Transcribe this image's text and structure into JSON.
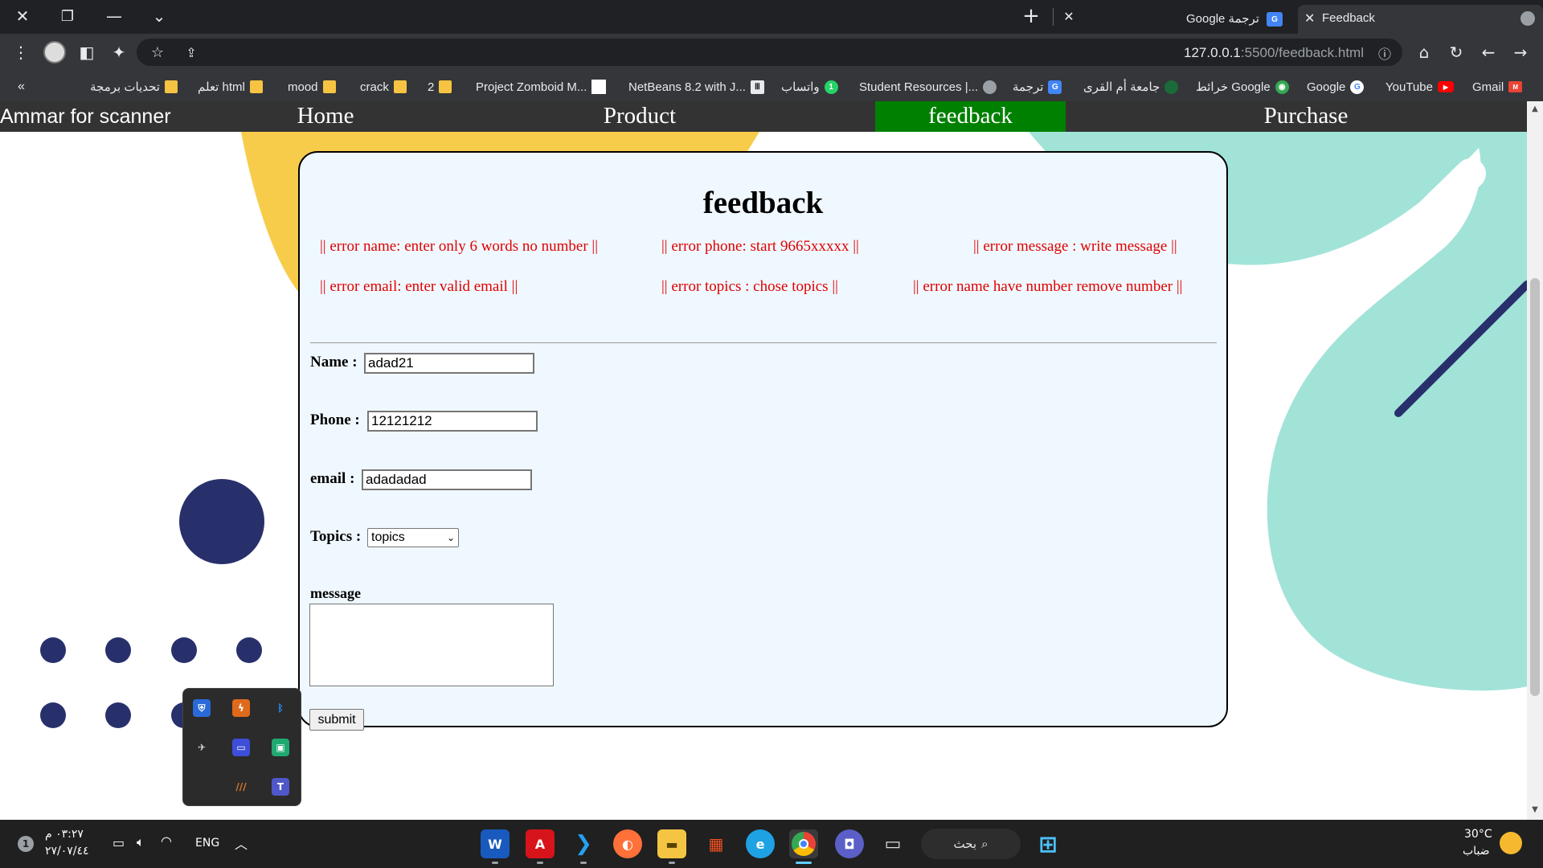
{
  "window": {
    "close_glyph": "✕",
    "restore_glyph": "❐",
    "minimize_glyph": "—",
    "tabsearch_glyph": "⌄"
  },
  "tabs": [
    {
      "title": "Feedback",
      "active": true
    },
    {
      "title": "Google ترجمة",
      "active": false
    }
  ],
  "tab_controls": {
    "new_tab_glyph": "+",
    "close_glyph": "✕"
  },
  "omnibox": {
    "url_host": "127.0.0.1",
    "url_rest": ":5500/feedback.html"
  },
  "bookmarks": [
    {
      "label": "Gmail",
      "icon": "gmail-icon",
      "color": "#ea4335"
    },
    {
      "label": "YouTube",
      "icon": "youtube-icon",
      "color": "#ff0000"
    },
    {
      "label": "Google",
      "icon": "google-icon",
      "color": "#4285f4"
    },
    {
      "label": "خرائط Google",
      "icon": "maps-icon",
      "color": "#34a853"
    },
    {
      "label": "جامعة أم القرى",
      "icon": "university-icon",
      "color": "#1b6b3a"
    },
    {
      "label": "ترجمة",
      "icon": "translate-icon",
      "color": "#4285f4"
    },
    {
      "label": "Student Resources |...",
      "icon": "globe-icon",
      "color": "#9aa0a6"
    },
    {
      "label": "واتساب",
      "icon": "whatsapp-icon",
      "color": "#25d366"
    },
    {
      "label": "NetBeans 8.2 with J...",
      "icon": "bank-icon",
      "color": "#e8eaed"
    },
    {
      "label": "Project Zomboid M...",
      "icon": "page-icon",
      "color": "#ffffff"
    },
    {
      "label": "2",
      "icon": "folder-icon",
      "color": "#f6c343"
    },
    {
      "label": "crack",
      "icon": "folder-icon",
      "color": "#f6c343"
    },
    {
      "label": "mood",
      "icon": "folder-icon",
      "color": "#f6c343"
    },
    {
      "label": "تعلم html",
      "icon": "folder-icon",
      "color": "#f6c343"
    },
    {
      "label": "تحديات برمجة",
      "icon": "folder-icon",
      "color": "#f6c343"
    }
  ],
  "bookmarks_more": "«",
  "site": {
    "brand": "Ammar for scanner",
    "nav": [
      {
        "label": "Home",
        "active": false
      },
      {
        "label": "Product",
        "active": false
      },
      {
        "label": "feedback",
        "active": true
      },
      {
        "label": "Purchase",
        "active": false
      }
    ],
    "nav_active_color": "#008000"
  },
  "form": {
    "title": "feedback",
    "errors": [
      "|| error name: enter only 6 words no number ||",
      "|| error phone: start 9665xxxxx ||",
      "|| error message : write message ||",
      "|| error email: enter valid email ||",
      "|| error topics : chose topics ||",
      "|| error name have number remove number ||"
    ],
    "error_color": "#e00000",
    "name_label": "Name :",
    "name_value": "adad21",
    "phone_label": "Phone :",
    "phone_value": "12121212",
    "email_label": "email :",
    "email_value": "adadadad",
    "topics_label": "Topics :",
    "topics_selected": "topics",
    "message_label": "message",
    "message_value": "",
    "submit_label": "submit"
  },
  "taskbar": {
    "search_label": "بحث",
    "weather_temp": "30°C",
    "weather_desc": "ضباب",
    "lang": "ENG",
    "time": "٠٣:٢٧ م",
    "date": "٢٧/٠٧/٤٤",
    "apps": [
      "word-icon",
      "acrobat-icon",
      "vscode-icon",
      "firefox-icon",
      "file-explorer-icon",
      "store-icon",
      "edge-icon",
      "chrome-icon",
      "teams-chat-icon",
      "desktop-icon"
    ]
  }
}
